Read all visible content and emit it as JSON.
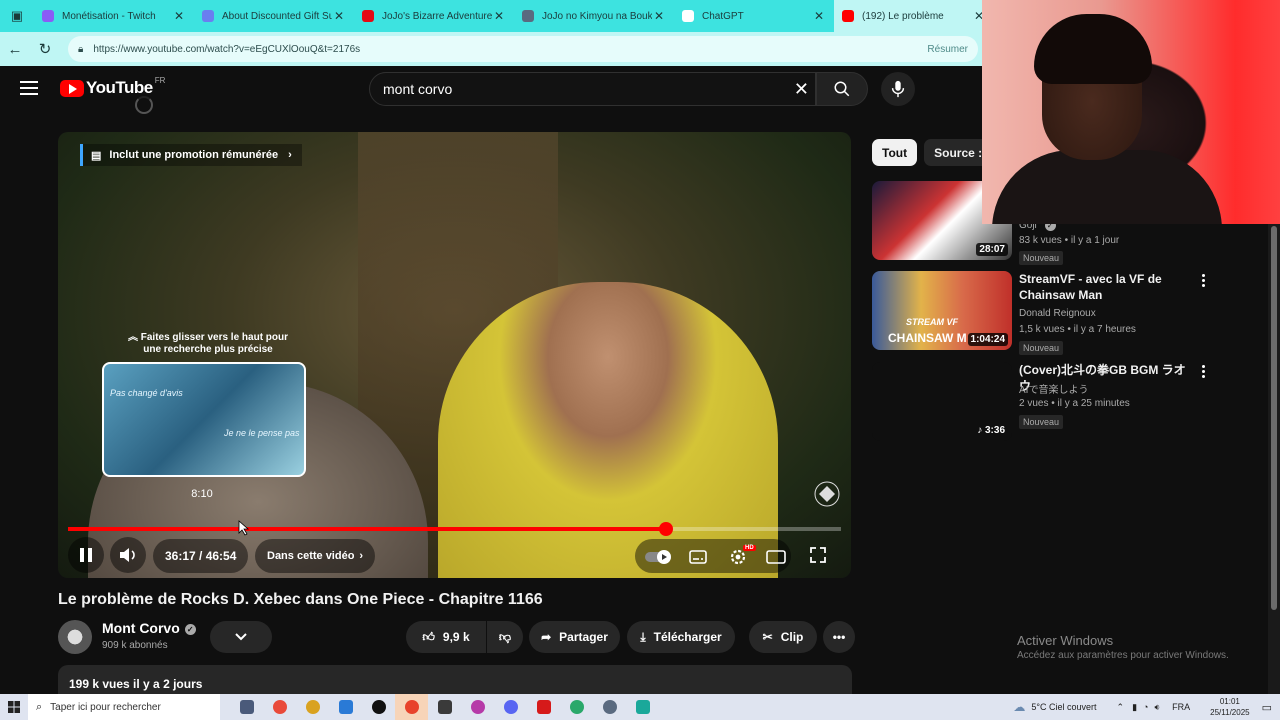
{
  "browser": {
    "tabs": [
      {
        "title": "Monétisation - Twitch",
        "color": "#8a5cf6"
      },
      {
        "title": "About Discounted Gift Subs",
        "color": "#6a7ef0"
      },
      {
        "title": "JoJo's Bizarre Adventure - N",
        "color": "#e50914"
      },
      {
        "title": "JoJo no Kimyou na Bouken",
        "color": "#5a6a80"
      },
      {
        "title": "ChatGPT",
        "color": "#ffffff"
      },
      {
        "title": "(192) Le problème",
        "color": "#ff0000"
      }
    ],
    "url": "https://www.youtube.com/watch?v=eEgCUXlOouQ&t=2176s",
    "resume_label": "Résumer"
  },
  "youtube": {
    "logo_text": "YouTube",
    "country_code": "FR",
    "search_query": "mont corvo"
  },
  "player": {
    "promo_label": "Inclut une promotion rémunérée",
    "seek_hint": "Faites glisser vers le haut pour une recherche plus précise",
    "preview_time": "8:10",
    "preview_caption_1": "Pas changé d'avis",
    "preview_caption_2": "Je ne le pense pas",
    "time_display": "36:17 / 46:54",
    "chapter_label": "Dans cette vidéo",
    "progress_fraction": 0.774,
    "hover_fraction": 0.222,
    "hd_badge": "HD"
  },
  "video": {
    "title": "Le problème de Rocks D. Xebec dans One Piece - Chapitre 1166",
    "channel": "Mont Corvo",
    "subscribers": "909 k abonnés",
    "likes": "9,9 k",
    "share_label": "Partager",
    "download_label": "Télécharger",
    "clip_label": "Clip",
    "views_date": "199 k vues  il y a 2 jours"
  },
  "chips": [
    {
      "label": "Tout",
      "active": true
    },
    {
      "label": "Source : M",
      "active": false
    }
  ],
  "recommendations": [
    {
      "title": "",
      "channel": "Goji",
      "meta": "83 k vues • il y a 1 jour",
      "duration": "28:07",
      "badge": "Nouveau"
    },
    {
      "title": "StreamVF - avec la VF de Chainsaw Man",
      "channel": "Donald Reignoux",
      "meta": "1,5 k vues • il y a 7 heures",
      "duration": "1:04:24",
      "badge": "Nouveau",
      "thumb_text_1": "STREAM VF",
      "thumb_text_2": "CHAINSAW M"
    },
    {
      "title": "(Cover)北斗の拳GB BGM ラオウ",
      "channel": "AIで音楽しよう",
      "meta": "2 vues • il y a 25 minutes",
      "duration": "3:36",
      "badge": "Nouveau"
    }
  ],
  "windows": {
    "activate_title": "Activer Windows",
    "activate_sub": "Accédez aux paramètres pour activer Windows.",
    "search_placeholder": "Taper ici pour rechercher",
    "weather": "5°C  Ciel couvert",
    "lang": "FRA",
    "time": "01:01",
    "date": "25/11/2025",
    "taskbar_apps": [
      "task-view",
      "chrome-app",
      "file-explorer",
      "edge",
      "tiktok",
      "opera",
      "obs",
      "davinci",
      "discord",
      "opera-gx",
      "app-green",
      "calculator",
      "app-teal"
    ]
  },
  "colors": {
    "accent_red": "#ff0000",
    "tab_bar": "#3de3e0",
    "tab_active": "#bff6f4"
  }
}
